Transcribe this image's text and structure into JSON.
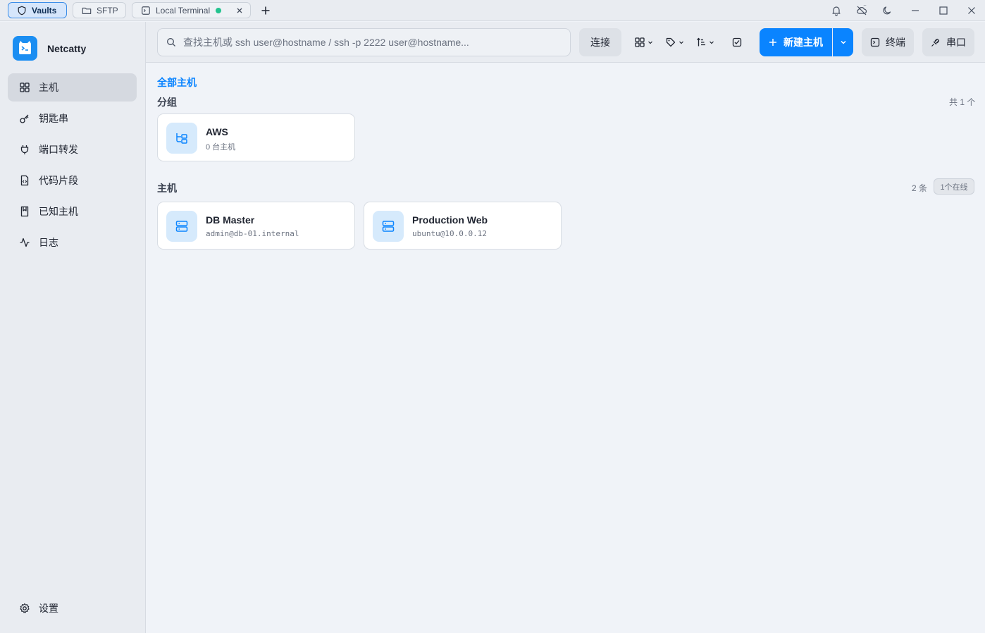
{
  "tabs": [
    {
      "label": "Vaults",
      "icon": "shield-icon",
      "active": true
    },
    {
      "label": "SFTP",
      "icon": "folder-icon",
      "active": false
    },
    {
      "label": "Local Terminal",
      "icon": "terminal-icon",
      "active": false,
      "status_color": "#22c38e"
    }
  ],
  "app": {
    "name": "Netcatty"
  },
  "sidebar": {
    "items": [
      {
        "label": "主机",
        "icon": "grid-icon",
        "active": true
      },
      {
        "label": "钥匙串",
        "icon": "key-icon"
      },
      {
        "label": "端口转发",
        "icon": "plug-icon"
      },
      {
        "label": "代码片段",
        "icon": "code-file-icon"
      },
      {
        "label": "已知主机",
        "icon": "bookmark-icon"
      },
      {
        "label": "日志",
        "icon": "activity-icon"
      }
    ],
    "settings_label": "设置"
  },
  "toolbar": {
    "search_placeholder": "查找主机或 ssh user@hostname / ssh -p 2222 user@hostname...",
    "connect_label": "连接",
    "new_host_label": "新建主机",
    "terminal_label": "终端",
    "serial_label": "串口"
  },
  "main": {
    "breadcrumb": "全部主机",
    "groups": {
      "title": "分组",
      "count": "共 1 个",
      "items": [
        {
          "name": "AWS",
          "sub": "0 台主机"
        }
      ]
    },
    "hosts": {
      "title": "主机",
      "count": "2 条",
      "online_badge": "1个在线",
      "items": [
        {
          "name": "DB Master",
          "sub": "admin@db-01.internal"
        },
        {
          "name": "Production Web",
          "sub": "ubuntu@10.0.0.12"
        }
      ]
    }
  },
  "colors": {
    "accent": "#0a84ff",
    "online": "#22c38e",
    "icon_bg": "#d6eafc"
  }
}
